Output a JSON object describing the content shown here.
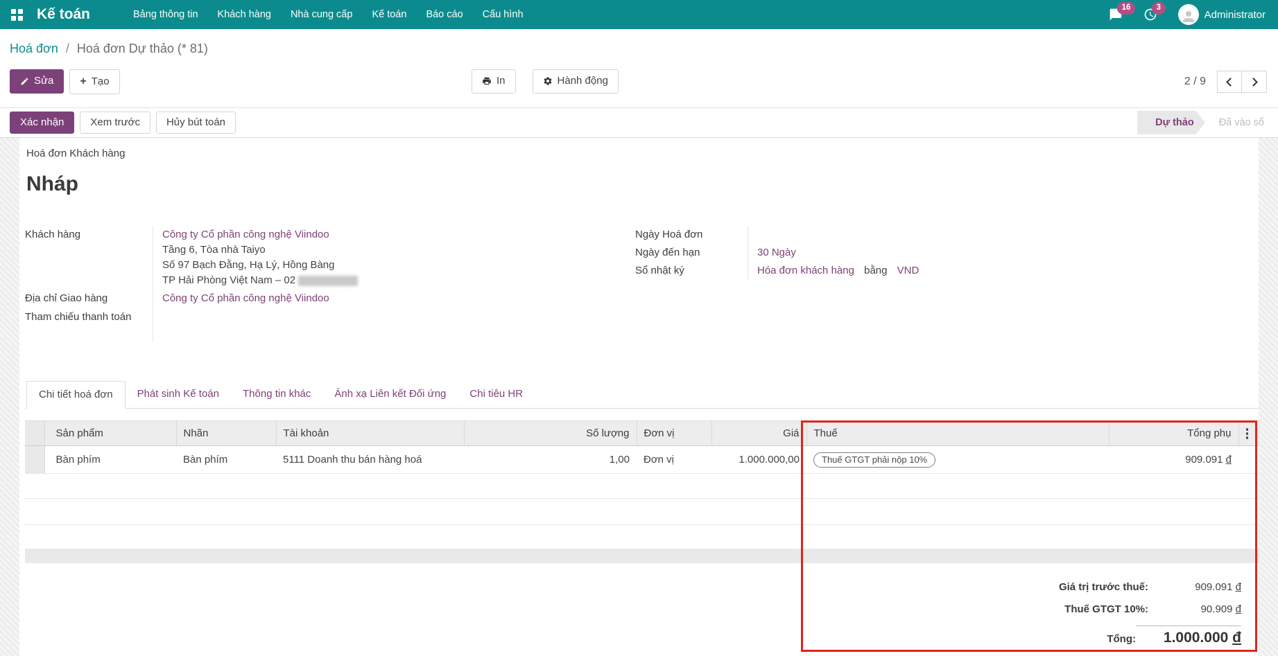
{
  "colors": {
    "topbar": "#0b8b8d",
    "primary": "#7c4178",
    "badge": "#b04f86",
    "highlight": "#e2231a"
  },
  "topbar": {
    "app_name": "Kế toán",
    "menus": [
      "Bảng thông tin",
      "Khách hàng",
      "Nhà cung cấp",
      "Kế toán",
      "Báo cáo",
      "Cấu hình"
    ],
    "badges": {
      "messages": "16",
      "activities": "3"
    },
    "user": "Administrator"
  },
  "breadcrumb": {
    "parent": "Hoá đơn",
    "sep": "/",
    "current": "Hoá đơn Dự thảo (* 81)"
  },
  "actions": {
    "edit": "Sửa",
    "create": "Tạo",
    "print": "In",
    "action": "Hành động",
    "pager": "2 / 9"
  },
  "statusbar": {
    "buttons": [
      "Xác nhận",
      "Xem trước",
      "Hủy bút toán"
    ],
    "states": [
      {
        "label": "Dự thảo",
        "active": true
      },
      {
        "label": "Đã vào sổ",
        "active": false
      }
    ]
  },
  "document": {
    "type_label": "Hoá đơn Khách hàng",
    "title": "Nháp",
    "fields_left": [
      {
        "label": "Khách hàng",
        "link": "Công ty Cổ phần công nghệ Viindoo",
        "address": [
          "Tầng 6, Tòa nhà Taiyo",
          "Số 97 Bạch Đằng, Hạ Lý, Hồng Bàng",
          "TP Hải Phòng Việt Nam – 02"
        ]
      },
      {
        "label": "Địa chỉ Giao hàng",
        "link": "Công ty Cổ phần công nghệ Viindoo"
      },
      {
        "label": "Tham chiếu thanh toán",
        "value": ""
      }
    ],
    "fields_right": [
      {
        "label": "Ngày Hoá đơn",
        "value": ""
      },
      {
        "label": "Ngày đến hạn",
        "value": "30 Ngày"
      },
      {
        "label": "Sổ nhật ký",
        "parts": [
          "Hóa đơn khách hàng",
          "bằng",
          "VND"
        ]
      }
    ]
  },
  "tabs": [
    {
      "label": "Chi tiết hoá đơn",
      "active": true
    },
    {
      "label": "Phát sinh Kế toán",
      "active": false
    },
    {
      "label": "Thông tin khác",
      "active": false
    },
    {
      "label": "Ánh xạ Liên kết Đối ứng",
      "active": false
    },
    {
      "label": "Chi tiêu HR",
      "active": false
    }
  ],
  "table": {
    "headers": [
      "Sản phẩm",
      "Nhãn",
      "Tài khoản",
      "Số lượng",
      "Đơn vị",
      "Giá",
      "Thuế",
      "Tổng phụ"
    ],
    "currency": "đ",
    "rows": [
      {
        "product": "Bàn phím",
        "label": "Bàn phím",
        "account": "5111 Doanh thu bán hàng hoá",
        "qty": "1,00",
        "uom": "Đơn vị",
        "price": "1.000.000,00",
        "tax": "Thuế GTGT phải nộp 10%",
        "subtotal": "909.091"
      }
    ]
  },
  "totals": {
    "currency": "đ",
    "rows": [
      {
        "label": "Giá trị trước thuế:",
        "value": "909.091"
      },
      {
        "label": "Thuế GTGT 10%:",
        "value": "90.909"
      }
    ],
    "total_label": "Tổng:",
    "total_value": "1.000.000"
  }
}
